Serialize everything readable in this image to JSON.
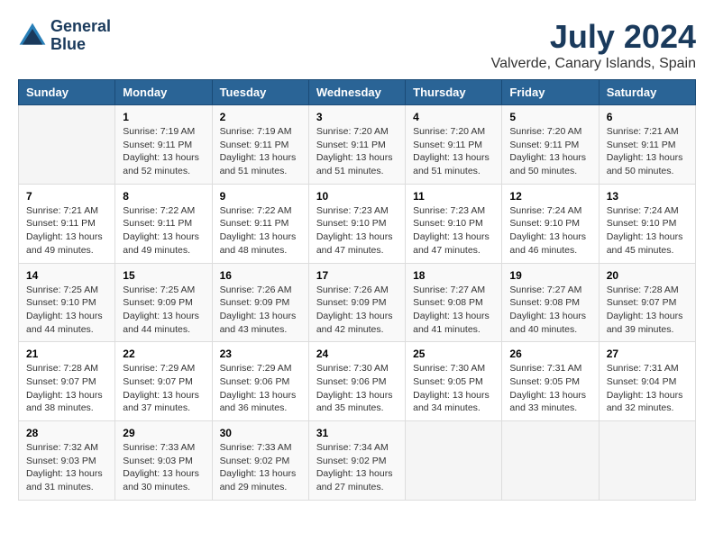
{
  "logo": {
    "line1": "General",
    "line2": "Blue"
  },
  "title": "July 2024",
  "location": "Valverde, Canary Islands, Spain",
  "headers": [
    "Sunday",
    "Monday",
    "Tuesday",
    "Wednesday",
    "Thursday",
    "Friday",
    "Saturday"
  ],
  "weeks": [
    [
      {
        "day": "",
        "info": ""
      },
      {
        "day": "1",
        "info": "Sunrise: 7:19 AM\nSunset: 9:11 PM\nDaylight: 13 hours\nand 52 minutes."
      },
      {
        "day": "2",
        "info": "Sunrise: 7:19 AM\nSunset: 9:11 PM\nDaylight: 13 hours\nand 51 minutes."
      },
      {
        "day": "3",
        "info": "Sunrise: 7:20 AM\nSunset: 9:11 PM\nDaylight: 13 hours\nand 51 minutes."
      },
      {
        "day": "4",
        "info": "Sunrise: 7:20 AM\nSunset: 9:11 PM\nDaylight: 13 hours\nand 51 minutes."
      },
      {
        "day": "5",
        "info": "Sunrise: 7:20 AM\nSunset: 9:11 PM\nDaylight: 13 hours\nand 50 minutes."
      },
      {
        "day": "6",
        "info": "Sunrise: 7:21 AM\nSunset: 9:11 PM\nDaylight: 13 hours\nand 50 minutes."
      }
    ],
    [
      {
        "day": "7",
        "info": "Sunrise: 7:21 AM\nSunset: 9:11 PM\nDaylight: 13 hours\nand 49 minutes."
      },
      {
        "day": "8",
        "info": "Sunrise: 7:22 AM\nSunset: 9:11 PM\nDaylight: 13 hours\nand 49 minutes."
      },
      {
        "day": "9",
        "info": "Sunrise: 7:22 AM\nSunset: 9:11 PM\nDaylight: 13 hours\nand 48 minutes."
      },
      {
        "day": "10",
        "info": "Sunrise: 7:23 AM\nSunset: 9:10 PM\nDaylight: 13 hours\nand 47 minutes."
      },
      {
        "day": "11",
        "info": "Sunrise: 7:23 AM\nSunset: 9:10 PM\nDaylight: 13 hours\nand 47 minutes."
      },
      {
        "day": "12",
        "info": "Sunrise: 7:24 AM\nSunset: 9:10 PM\nDaylight: 13 hours\nand 46 minutes."
      },
      {
        "day": "13",
        "info": "Sunrise: 7:24 AM\nSunset: 9:10 PM\nDaylight: 13 hours\nand 45 minutes."
      }
    ],
    [
      {
        "day": "14",
        "info": "Sunrise: 7:25 AM\nSunset: 9:10 PM\nDaylight: 13 hours\nand 44 minutes."
      },
      {
        "day": "15",
        "info": "Sunrise: 7:25 AM\nSunset: 9:09 PM\nDaylight: 13 hours\nand 44 minutes."
      },
      {
        "day": "16",
        "info": "Sunrise: 7:26 AM\nSunset: 9:09 PM\nDaylight: 13 hours\nand 43 minutes."
      },
      {
        "day": "17",
        "info": "Sunrise: 7:26 AM\nSunset: 9:09 PM\nDaylight: 13 hours\nand 42 minutes."
      },
      {
        "day": "18",
        "info": "Sunrise: 7:27 AM\nSunset: 9:08 PM\nDaylight: 13 hours\nand 41 minutes."
      },
      {
        "day": "19",
        "info": "Sunrise: 7:27 AM\nSunset: 9:08 PM\nDaylight: 13 hours\nand 40 minutes."
      },
      {
        "day": "20",
        "info": "Sunrise: 7:28 AM\nSunset: 9:07 PM\nDaylight: 13 hours\nand 39 minutes."
      }
    ],
    [
      {
        "day": "21",
        "info": "Sunrise: 7:28 AM\nSunset: 9:07 PM\nDaylight: 13 hours\nand 38 minutes."
      },
      {
        "day": "22",
        "info": "Sunrise: 7:29 AM\nSunset: 9:07 PM\nDaylight: 13 hours\nand 37 minutes."
      },
      {
        "day": "23",
        "info": "Sunrise: 7:29 AM\nSunset: 9:06 PM\nDaylight: 13 hours\nand 36 minutes."
      },
      {
        "day": "24",
        "info": "Sunrise: 7:30 AM\nSunset: 9:06 PM\nDaylight: 13 hours\nand 35 minutes."
      },
      {
        "day": "25",
        "info": "Sunrise: 7:30 AM\nSunset: 9:05 PM\nDaylight: 13 hours\nand 34 minutes."
      },
      {
        "day": "26",
        "info": "Sunrise: 7:31 AM\nSunset: 9:05 PM\nDaylight: 13 hours\nand 33 minutes."
      },
      {
        "day": "27",
        "info": "Sunrise: 7:31 AM\nSunset: 9:04 PM\nDaylight: 13 hours\nand 32 minutes."
      }
    ],
    [
      {
        "day": "28",
        "info": "Sunrise: 7:32 AM\nSunset: 9:03 PM\nDaylight: 13 hours\nand 31 minutes."
      },
      {
        "day": "29",
        "info": "Sunrise: 7:33 AM\nSunset: 9:03 PM\nDaylight: 13 hours\nand 30 minutes."
      },
      {
        "day": "30",
        "info": "Sunrise: 7:33 AM\nSunset: 9:02 PM\nDaylight: 13 hours\nand 29 minutes."
      },
      {
        "day": "31",
        "info": "Sunrise: 7:34 AM\nSunset: 9:02 PM\nDaylight: 13 hours\nand 27 minutes."
      },
      {
        "day": "",
        "info": ""
      },
      {
        "day": "",
        "info": ""
      },
      {
        "day": "",
        "info": ""
      }
    ]
  ]
}
